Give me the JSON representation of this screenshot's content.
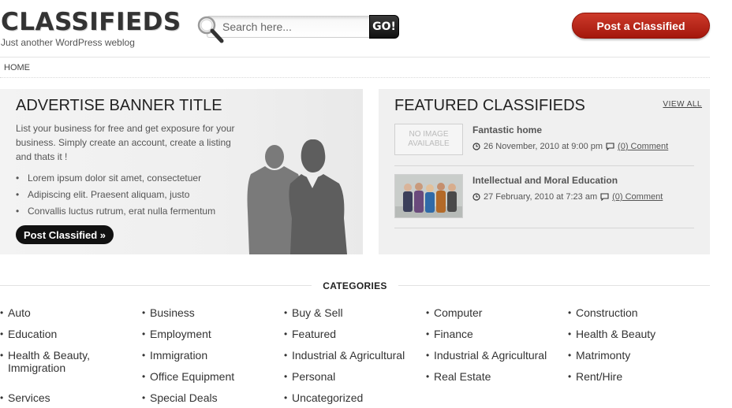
{
  "header": {
    "site_title": "CLASSIFIEDS",
    "tagline": "Just another WordPress weblog",
    "search_placeholder": "Search here...",
    "search_button": "GO!",
    "post_button": "Post a Classified"
  },
  "nav": {
    "home": "HOME"
  },
  "banner": {
    "title": "ADVERTISE BANNER TITLE",
    "text": "List your business for free and get exposure for your business. Simply create an account, create a listing and thats it !",
    "bullets": [
      "Lorem ipsum dolor sit amet, consectetuer",
      "Adipiscing elit. Praesent aliquam, justo",
      "Convallis luctus rutrum, erat nulla fermentum"
    ],
    "button": "Post Classified »"
  },
  "featured": {
    "title": "FEATURED CLASSIFIEDS",
    "view_all": "VIEW ALL",
    "items": [
      {
        "thumb": "NO IMAGE AVAILABLE",
        "title": "Fantastic home",
        "date": "26 November, 2010 at 9:00 pm",
        "comments": "(0) Comment"
      },
      {
        "title": "Intellectual and Moral Education",
        "date": "27 February, 2010 at 7:23 am",
        "comments": "(0) Comment"
      }
    ]
  },
  "categories": {
    "title": "CATEGORIES",
    "items": [
      "Auto",
      "Business",
      "Buy & Sell",
      "Computer",
      "Construction",
      "Education",
      "Employment",
      "Featured",
      "Finance",
      "Health & Beauty",
      "Health & Beauty, Immigration",
      "Immigration",
      "Industrial & Agricultural",
      "Industrial & Agricultural",
      "Matrimonty",
      "Office Equipment",
      "Personal",
      "Real Estate",
      "Rent/Hire",
      "Services",
      "Special Deals",
      "Uncategorized"
    ]
  },
  "colors": {
    "accent_red": "#b3231a",
    "dark": "#111111"
  }
}
